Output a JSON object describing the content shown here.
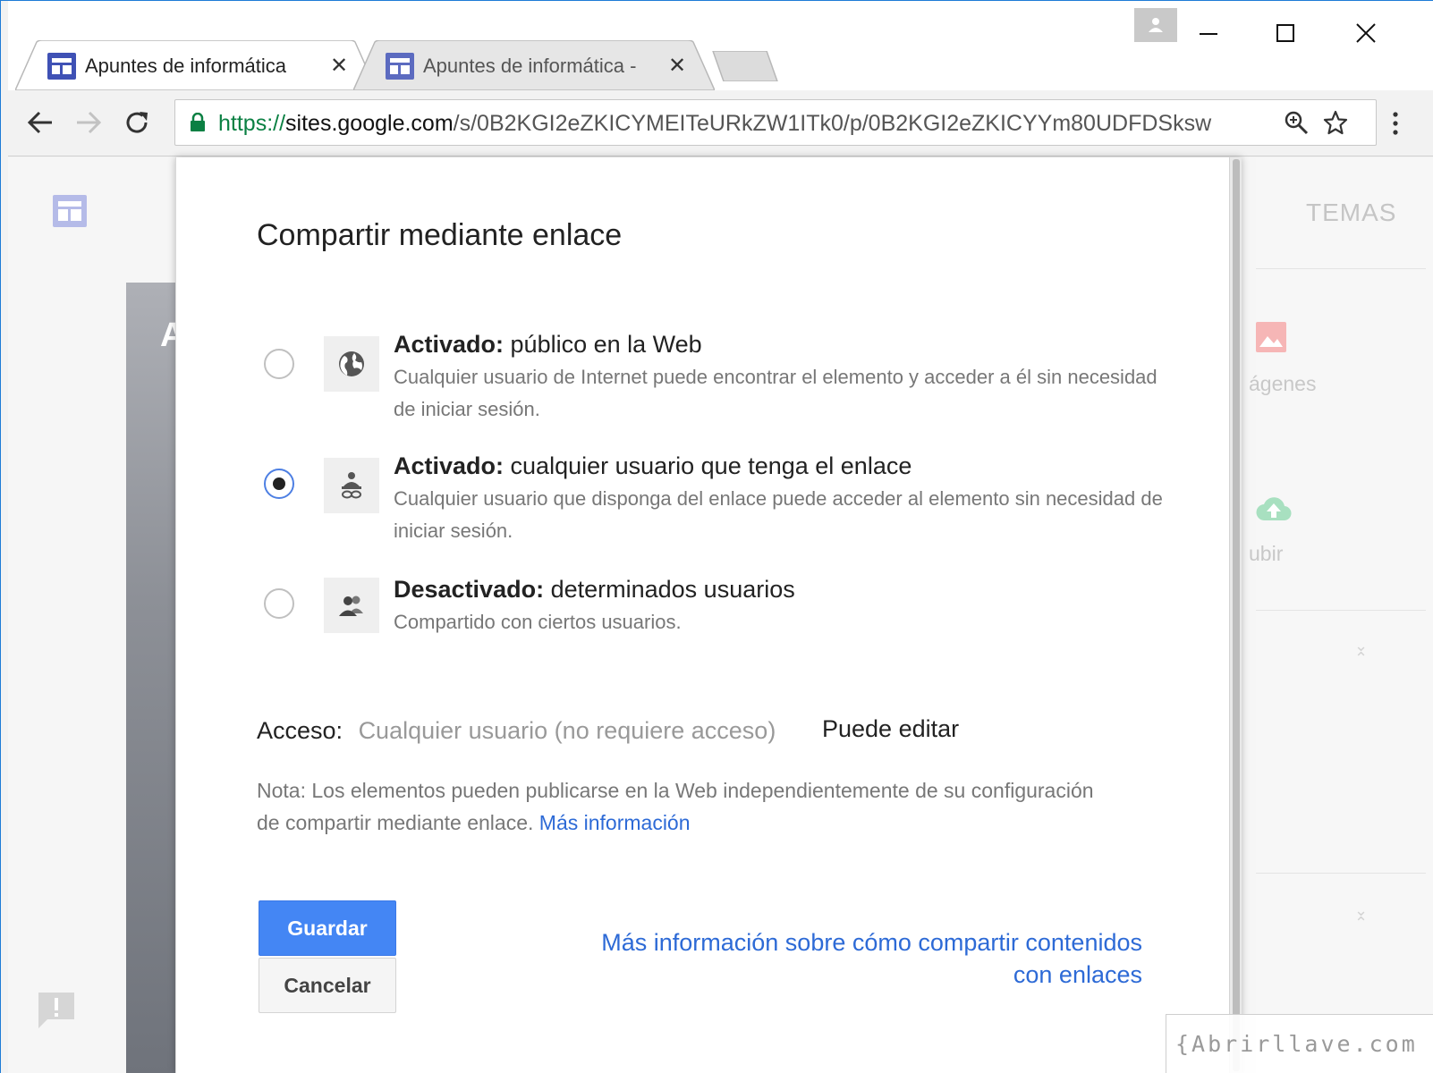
{
  "browser": {
    "tabs": [
      {
        "title": "Apuntes de informática",
        "active": true
      },
      {
        "title": "Apuntes de informática -",
        "active": false
      }
    ],
    "url": {
      "scheme": "https://",
      "host": "sites.google.com",
      "path": "/s/0B2KGI2eZKICYMEITeURkZW1ITk0/p/0B2KGI2eZKICYYm80UDFDSksw"
    },
    "icons": {
      "back": "back-arrow-icon",
      "forward": "forward-arrow-icon",
      "reload": "reload-icon",
      "lock": "lock-icon",
      "zoom": "zoom-icon",
      "bookmark": "star-icon",
      "menu": "menu-icon"
    }
  },
  "page": {
    "right_panel": {
      "temas": "TEMAS",
      "images_label": "ágenes",
      "upload_label": "ubir"
    },
    "bg_letter": "A"
  },
  "dialog": {
    "title": "Compartir mediante enlace",
    "options": [
      {
        "title_bold": "Activado:",
        "title_rest": " público en la Web",
        "description": "Cualquier usuario de Internet puede encontrar el elemento y acceder a él sin necesidad de iniciar sesión.",
        "icon": "globe-icon",
        "selected": false
      },
      {
        "title_bold": "Activado:",
        "title_rest": " cualquier usuario que tenga el enlace",
        "description": "Cualquier usuario que disponga del enlace puede acceder al elemento sin necesidad de iniciar sesión.",
        "icon": "person-link-icon",
        "selected": true
      },
      {
        "title_bold": "Desactivado:",
        "title_rest": " determinados usuarios",
        "description": "Compartido con ciertos usuarios.",
        "icon": "people-icon",
        "selected": false
      }
    ],
    "access_label": "Acceso:",
    "access_who": "Cualquier usuario (no requiere acceso)",
    "access_permission": "Puede editar",
    "note_text": "Nota: Los elementos pueden publicarse en la Web independientemente de su configuración de compartir mediante enlace.",
    "note_link": "Más información",
    "save_label": "Guardar",
    "cancel_label": "Cancelar",
    "learn_more_link": "Más información sobre cómo compartir contenidos con enlaces"
  },
  "watermark": "{Abrirllave.com",
  "colors": {
    "accent": "#4486f4",
    "link": "#2d6ad6",
    "secure": "#0b8043",
    "window_border": "#1e7bd6"
  }
}
